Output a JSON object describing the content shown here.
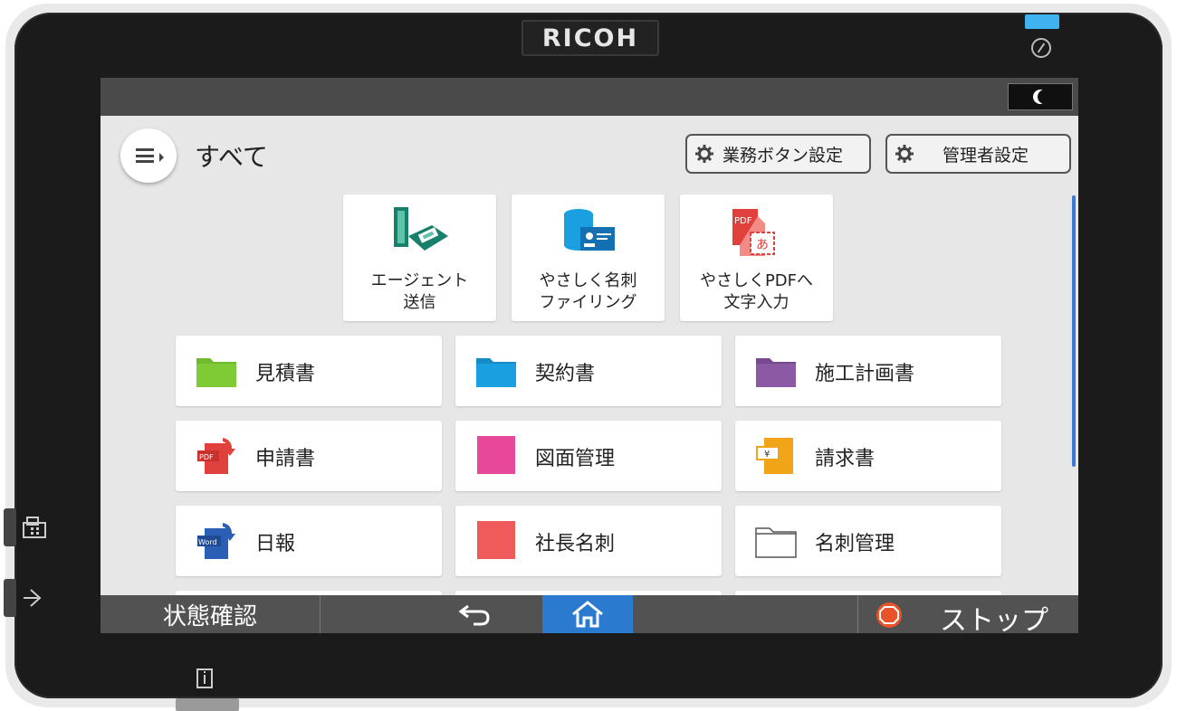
{
  "device": {
    "brand": "RICOH"
  },
  "topbar": {
    "energy_saver_icon": "moon-icon"
  },
  "header": {
    "title": "すべて",
    "menu_icon": "menu-icon",
    "job_button_settings": "業務ボタン設定",
    "admin_settings": "管理者設定"
  },
  "apps": [
    {
      "label_line1": "エージェント",
      "label_line2": "送信",
      "icon": "agent-send-icon"
    },
    {
      "label_line1": "やさしく名刺",
      "label_line2": "ファイリング",
      "icon": "business-card-filing-icon"
    },
    {
      "label_line1": "やさしくPDFへ",
      "label_line2": "文字入力",
      "icon": "pdf-text-input-icon"
    }
  ],
  "app_icon_text": {
    "pdf": "PDF",
    "a": "あ",
    "word": "Word",
    "yen": "¥"
  },
  "buttons": [
    {
      "label": "見積書",
      "icon": "green-folder-icon",
      "color": "#6fbb2c"
    },
    {
      "label": "契約書",
      "icon": "blue-folder-icon",
      "color": "#1a9fe0"
    },
    {
      "label": "施工計画書",
      "icon": "purple-folder-icon",
      "color": "#8c5aa5"
    },
    {
      "label": "申請書",
      "icon": "pdf-scan-icon",
      "color": "#e0413c"
    },
    {
      "label": "図面管理",
      "icon": "pink-square-icon",
      "color": "#e8489a"
    },
    {
      "label": "請求書",
      "icon": "yen-document-icon",
      "color": "#f0a418"
    },
    {
      "label": "日報",
      "icon": "word-scan-icon",
      "color": "#2b5fb4"
    },
    {
      "label": "社長名刺",
      "icon": "red-square-icon",
      "color": "#ef5b5b"
    },
    {
      "label": "名刺管理",
      "icon": "empty-folder-icon",
      "color": "#ffffff"
    }
  ],
  "bottombar": {
    "status_check": "状態確認",
    "back_icon": "back-arrow-icon",
    "home_icon": "home-icon",
    "stop": "ストップ"
  },
  "colors": {
    "accent": "#2a7ad0",
    "stop": "#e8532a",
    "power_led": "#3fb3ef"
  }
}
